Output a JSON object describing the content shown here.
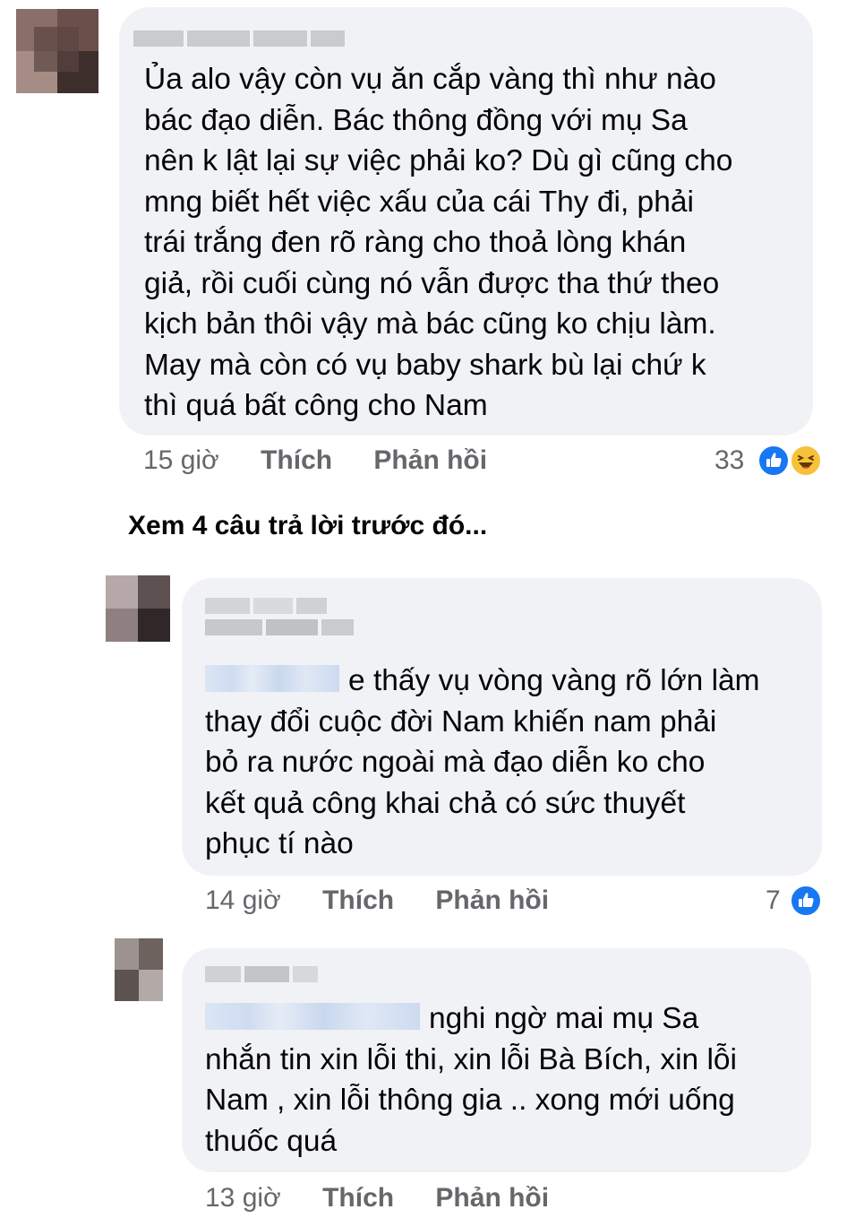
{
  "comments": [
    {
      "lines": [
        "Ủa alo vậy còn vụ ăn cắp vàng thì như nào",
        "bác đạo diễn. Bác thông đồng với mụ Sa",
        "nên k lật lại sự việc phải ko? Dù gì cũng cho",
        "mng biết hết việc xấu của cái Thy đi, phải",
        "trái trắng đen rõ ràng cho thoả lòng khán",
        "giả, rồi cuối cùng nó vẫn được tha thứ theo",
        "kịch bản thôi vậy mà bác cũng ko chịu làm.",
        "May mà còn có vụ baby shark bù lại chứ k",
        "thì quá bất công cho Nam"
      ],
      "time": "15 giờ",
      "like_label": "Thích",
      "reply_label": "Phản hồi",
      "reaction_count": "33",
      "reactions": [
        "like-icon",
        "haha-icon"
      ]
    },
    {
      "lines": [
        "e thấy vụ vòng vàng rõ lớn làm",
        "thay đổi cuộc đời Nam khiến nam phải",
        "bỏ ra nước ngoài mà đạo diễn ko cho",
        "kết quả công khai chả có sức thuyết",
        "phục tí nào"
      ],
      "time": "14 giờ",
      "like_label": "Thích",
      "reply_label": "Phản hồi",
      "reaction_count": "7",
      "reactions": [
        "like-icon"
      ]
    },
    {
      "lines": [
        "nghi ngờ mai mụ Sa",
        "nhắn tin xin lỗi thi, xin lỗi Bà Bích, xin lỗi",
        "Nam , xin lỗi thông gia .. xong mới uống",
        "thuốc quá"
      ],
      "time": "13 giờ",
      "like_label": "Thích",
      "reply_label": "Phản hồi"
    }
  ],
  "view_previous_replies": "Xem 4 câu trả lời trước đó...",
  "colors": {
    "bubble": "#f0f2f5",
    "meta_text": "#65676b",
    "like_blue": "#1877f2",
    "haha_yellow": "#f7c23a"
  }
}
